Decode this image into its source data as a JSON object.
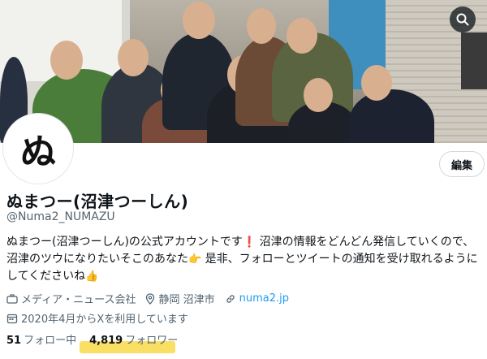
{
  "header": {
    "search_icon": "search-icon"
  },
  "profile": {
    "avatar_text": "ぬ",
    "edit_label": "編集",
    "display_name": "ぬまつー(沼津つーしん)",
    "handle": "@Numa2_NUMAZU",
    "bio_part1": "ぬまつー(沼津つーしん)の公式アカウントです",
    "bio_part2": " 沼津の情報をどんどん発信していくので、沼津のツウになりたいそこのあなた",
    "bio_part3": " 是非、フォローとツイートの通知を受け取れるようにしてくださいね",
    "category": "メディア・ニュース会社",
    "location": "静岡 沼津市",
    "website": "numa2.jp",
    "joined": "2020年4月からXを利用しています"
  },
  "stats": {
    "following_count": "51",
    "following_label": "フォロー中",
    "followers_count": "4,819",
    "followers_label": "フォロワー"
  },
  "colors": {
    "accent": "#1d9bf0",
    "highlight": "#f9d94a",
    "secondary_text": "#536471"
  }
}
